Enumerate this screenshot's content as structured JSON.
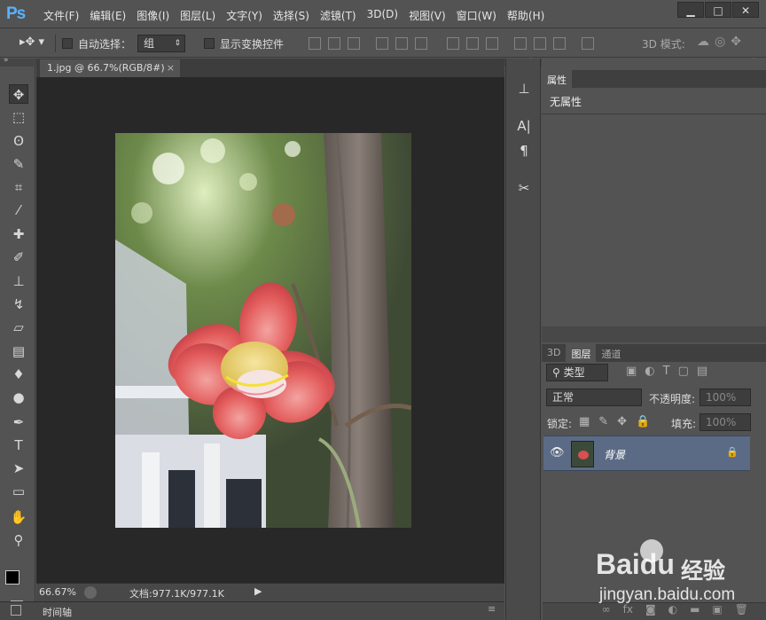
{
  "app": {
    "logo": "Ps"
  },
  "menu": [
    "文件(F)",
    "编辑(E)",
    "图像(I)",
    "图层(L)",
    "文字(Y)",
    "选择(S)",
    "滤镜(T)",
    "3D(D)",
    "视图(V)",
    "窗口(W)",
    "帮助(H)"
  ],
  "window_buttons": {
    "minimize": "▁",
    "restore": "□",
    "close": "✕"
  },
  "options": {
    "auto_select_label": "自动选择：",
    "auto_select_value": "组",
    "show_transform_label": "显示变换控件",
    "mode_3d_label": "3D 模式:"
  },
  "document": {
    "tab_title": "1.jpg @ 66.7%(RGB/8#)",
    "tab_close": "×",
    "zoom": "66.67%",
    "doc_info": "文档:977.1K/977.1K"
  },
  "timeline_label": "时间轴",
  "properties": {
    "tab": "属性",
    "content": "无属性"
  },
  "layers_panel": {
    "tabs": [
      "3D",
      "图层",
      "通道"
    ],
    "filter_kind": "类型",
    "blend_mode": "正常",
    "opacity_label": "不透明度:",
    "opacity_value": "100%",
    "lock_label": "锁定:",
    "fill_label": "填充:",
    "fill_value": "100%",
    "layers": [
      {
        "name": "背景",
        "visible": true,
        "locked": true
      }
    ]
  },
  "watermark": {
    "brand": "Baidu",
    "cn": "经验",
    "url": "jingyan.baidu.com"
  },
  "colors": {
    "ui_bg": "#535353",
    "dark": "#282828",
    "accent_logo": "#59b2ff",
    "layer_selected": "#5c6b85"
  }
}
